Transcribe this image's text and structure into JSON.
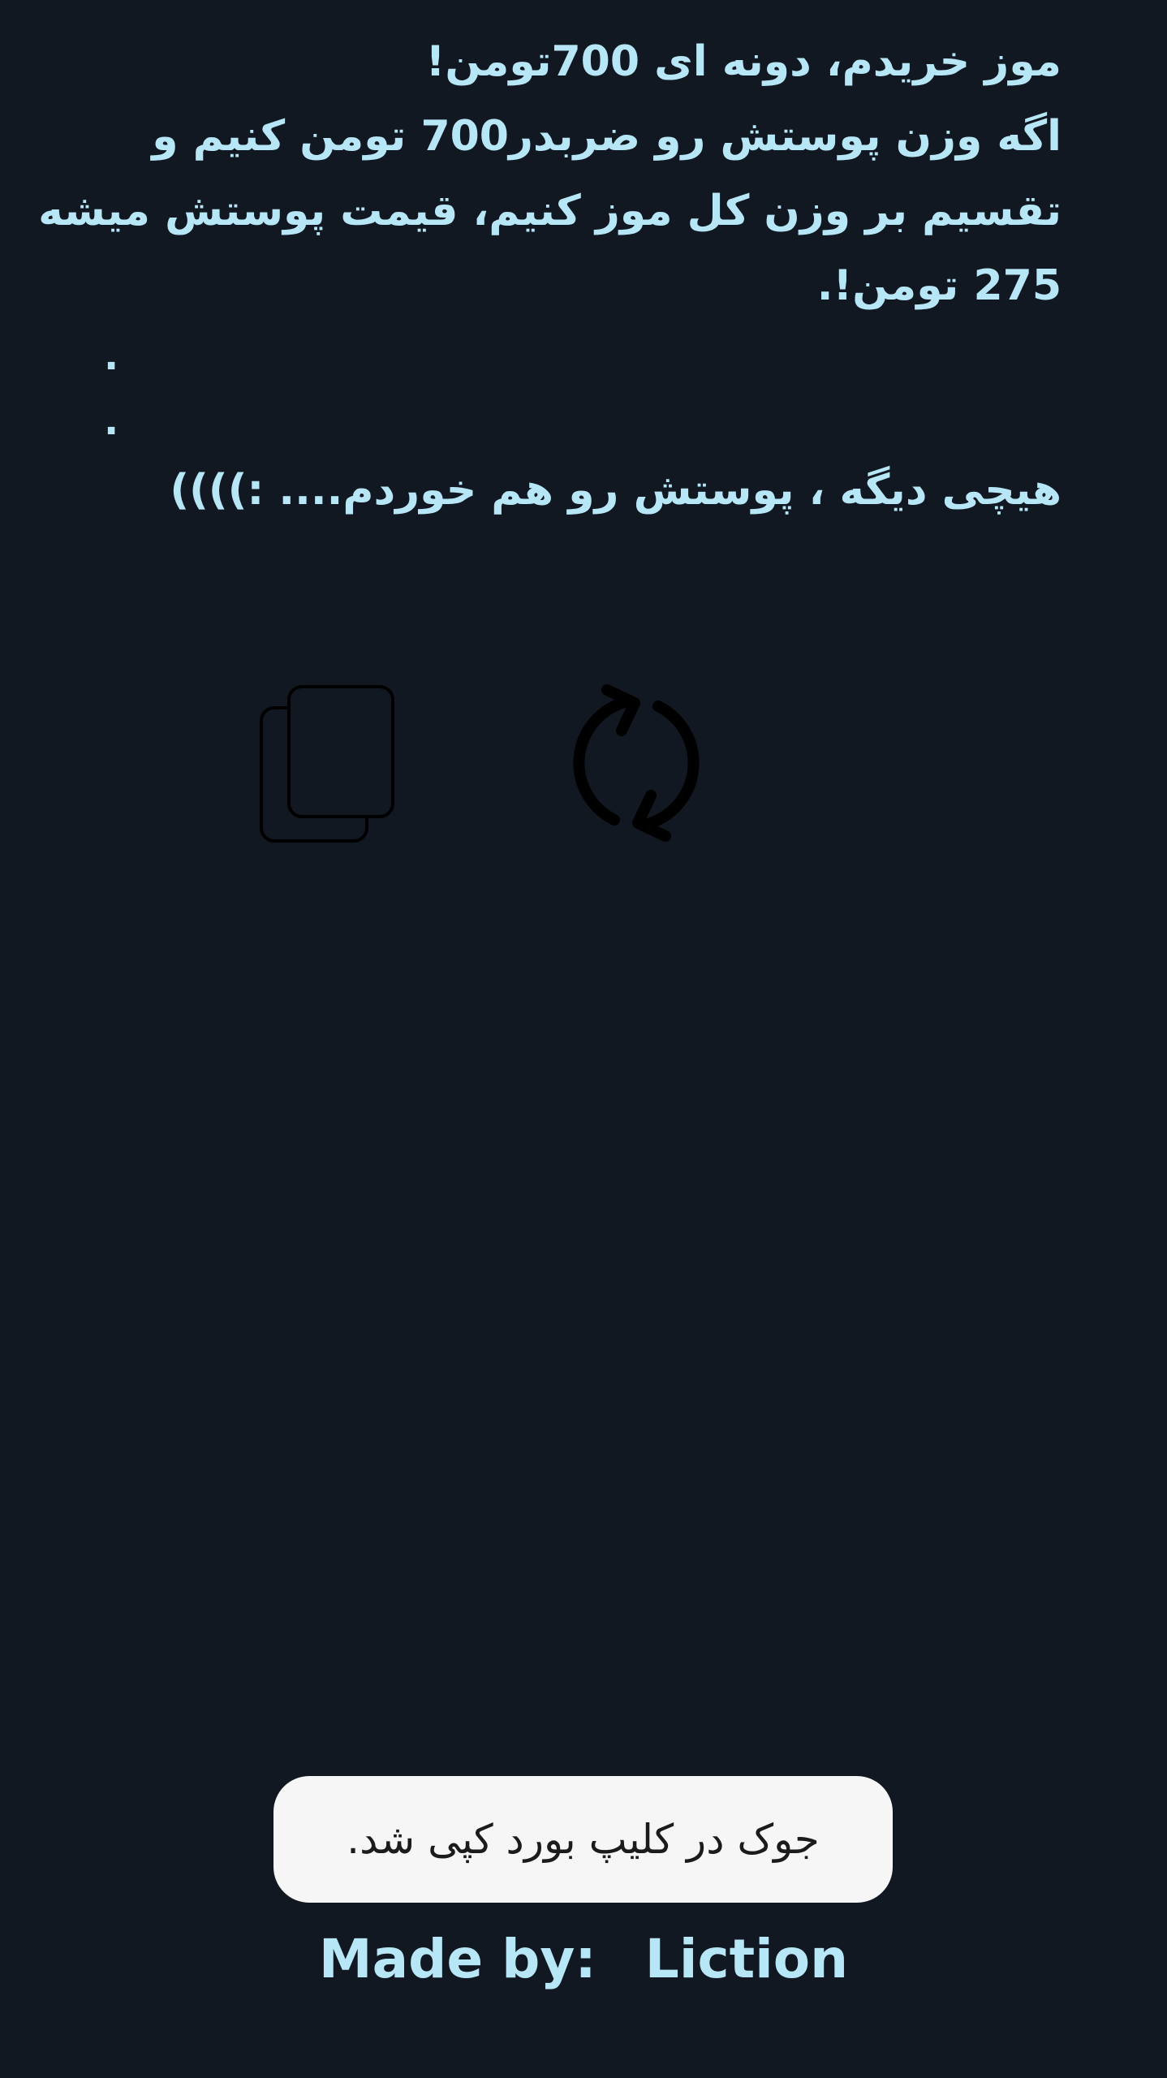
{
  "joke": {
    "line1": "موز خریدم، دونه ای 700تومن!",
    "line2": "اگه وزن پوستش رو ضربدر700 تومن کنیم و",
    "line3": "تقسیم بر وزن کل موز کنیم، قیمت پوستش میشه",
    "line4": "275 تومن!.",
    "dot1": ".",
    "dot2": ".",
    "line5": "هیچی دیگه ، پوستش رو هم خوردم.... :))))"
  },
  "actions": {
    "copy_icon": "copy-icon",
    "refresh_icon": "refresh-icon"
  },
  "toast": {
    "message": "جوک در کلیپ بورد کپی شد."
  },
  "footer": {
    "made_by_label": "Made by:",
    "author": "Liction"
  },
  "colors": {
    "background": "#111821",
    "text_accent": "#b7e7f6",
    "toast_background": "#f6f6f6",
    "toast_text": "#1b1b1b",
    "icon": "#000000"
  }
}
